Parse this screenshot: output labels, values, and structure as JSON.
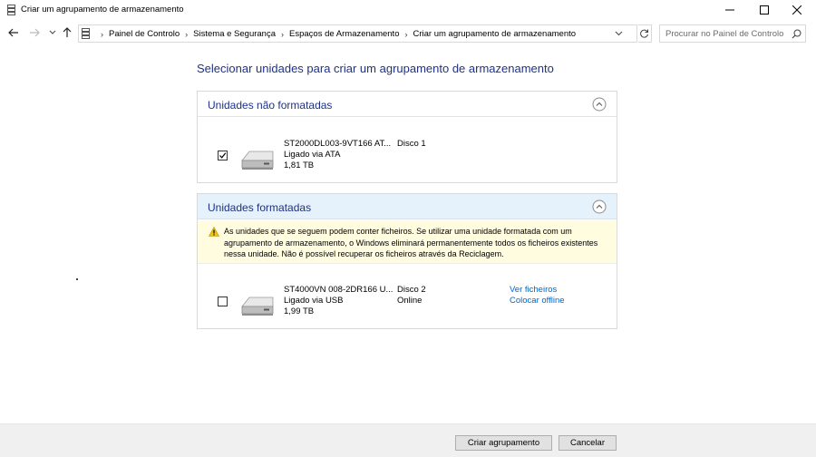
{
  "window": {
    "title": "Criar um agrupamento de armazenamento",
    "icon": "storage-spaces-icon"
  },
  "address": {
    "breadcrumbs": [
      "Painel de Controlo",
      "Sistema e Segurança",
      "Espaços de Armazenamento",
      "Criar um agrupamento de armazenamento"
    ],
    "search_placeholder": "Procurar no Painel de Controlo"
  },
  "main": {
    "heading": "Selecionar unidades para criar um agrupamento de armazenamento",
    "unformatted": {
      "title": "Unidades não formatadas",
      "drives": [
        {
          "name": "ST2000DL003-9VT166 AT...",
          "connection": "Ligado via ATA",
          "size": "1,81 TB",
          "disk": "Disco 1",
          "status": "",
          "checked": true
        }
      ]
    },
    "formatted": {
      "title": "Unidades formatadas",
      "warning": "As unidades que se seguem podem conter ficheiros. Se utilizar uma unidade formatada com um agrupamento de armazenamento, o Windows eliminará permanentemente todos os ficheiros existentes nessa unidade. Não é possível recuperar os ficheiros através da Reciclagem.",
      "drives": [
        {
          "name": "ST4000VN 008-2DR166 U...",
          "connection": "Ligado via USB",
          "size": "1,99 TB",
          "disk": "Disco 2",
          "status": "Online",
          "checked": false,
          "links": [
            "Ver ficheiros",
            "Colocar offline"
          ]
        }
      ]
    }
  },
  "footer": {
    "create_label": "Criar agrupamento",
    "cancel_label": "Cancelar"
  },
  "colors": {
    "heading": "#1e3287",
    "link": "#0066cc",
    "warning_bg": "#fffce0",
    "formatted_header_bg": "#e5f1fb"
  }
}
